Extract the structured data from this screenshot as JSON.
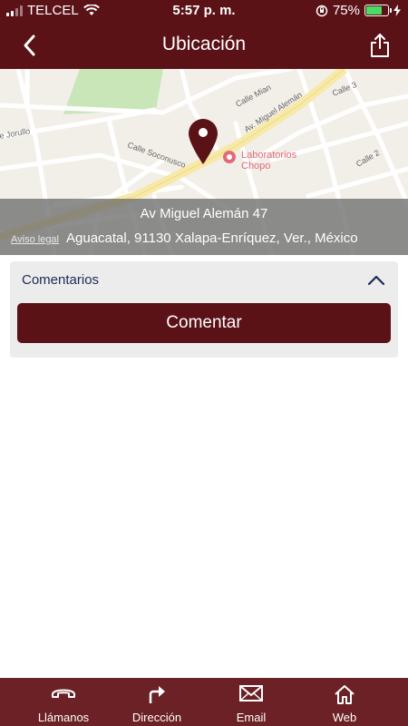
{
  "status_bar": {
    "carrier": "TELCEL",
    "time": "5:57 p. m.",
    "battery_pct": "75%",
    "battery_fraction": 0.75
  },
  "nav": {
    "title": "Ubicación",
    "back_icon": "chevron-left-icon",
    "share_icon": "share-icon"
  },
  "map": {
    "streets": [
      "Calle Mian",
      "Av. Miguel Alemán",
      "Calle 3",
      "e Jorullo",
      "Calle Soconusco",
      "Calle 2"
    ],
    "poi": "Laboratorios Chopo",
    "address_line1": "Av Miguel Alemán 47",
    "address_line2": "Aguacatal, 91130 Xalapa-Enríquez, Ver., México",
    "legal_link": "Aviso legal"
  },
  "comments": {
    "header": "Comentarios",
    "button_label": "Comentar"
  },
  "tab_bar": {
    "items": [
      {
        "label": "Llámanos",
        "icon": "phone-icon"
      },
      {
        "label": "Dirección",
        "icon": "direction-arrow-icon"
      },
      {
        "label": "Email",
        "icon": "envelope-icon"
      },
      {
        "label": "Web",
        "icon": "home-icon"
      }
    ]
  },
  "colors": {
    "brand": "#5a1217",
    "tab_bar": "#6b2126",
    "map_park": "#c8e6b8",
    "poi_text": "#e06a7a"
  }
}
